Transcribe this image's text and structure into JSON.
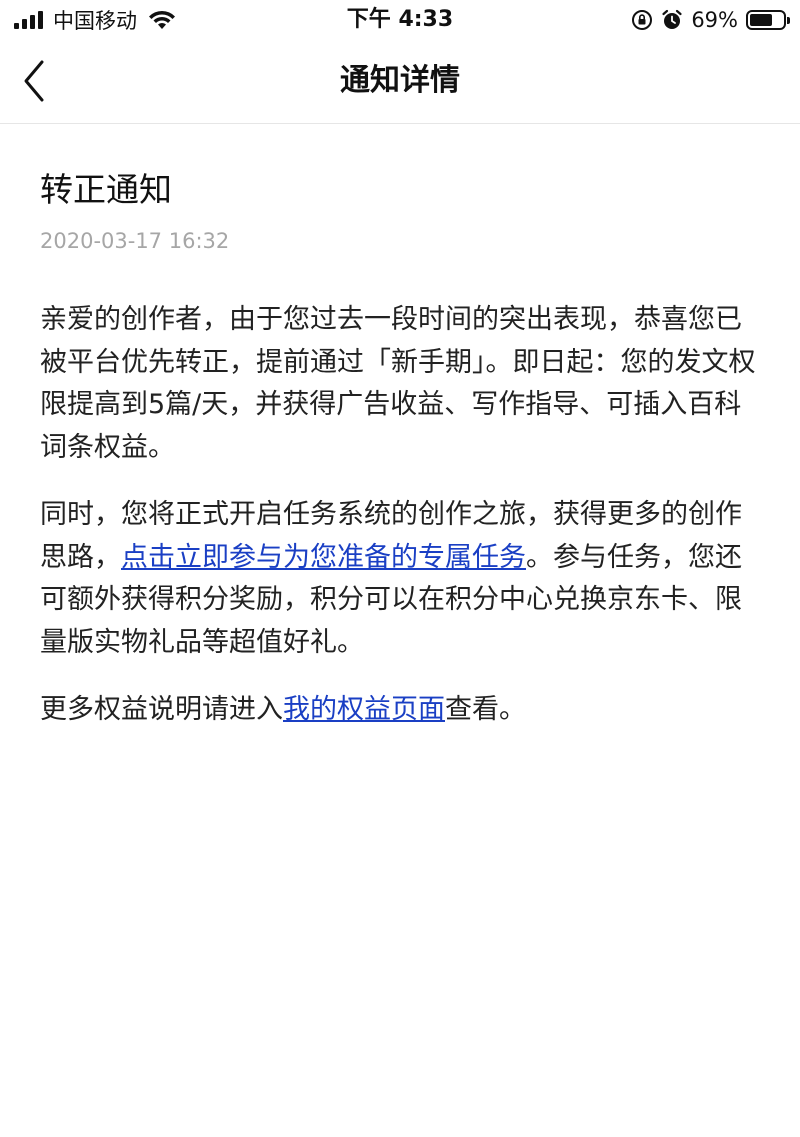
{
  "status_bar": {
    "carrier": "中国移动",
    "time": "下午 4:33",
    "battery_percent": "69%",
    "battery_level": 0.69,
    "icons": [
      "signal-icon",
      "wifi-icon",
      "orientation-lock-icon",
      "alarm-icon",
      "battery-icon"
    ]
  },
  "nav": {
    "title": "通知详情",
    "back_icon": "chevron-left-icon"
  },
  "notice": {
    "title": "转正通知",
    "date": "2020-03-17 16:32",
    "paragraph1": "亲爱的创作者，由于您过去一段时间的突出表现，恭喜您已被平台优先转正，提前通过「新手期」。即日起：您的发文权限提高到5篇/天，并获得广告收益、写作指导、可插入百科词条权益。",
    "paragraph2_before": "同时，您将正式开启任务系统的创作之旅，获得更多的创作思路，",
    "paragraph2_link": "点击立即参与为您准备的专属任务",
    "paragraph2_after": "。参与任务，您还可额外获得积分奖励，积分可以在积分中心兑换京东卡、限量版实物礼品等超值好礼。",
    "paragraph3_before": "更多权益说明请进入",
    "paragraph3_link": "我的权益页面",
    "paragraph3_after": "查看。"
  },
  "colors": {
    "link": "#1a3fc4",
    "date": "#a6a6a6",
    "text": "#222222"
  }
}
